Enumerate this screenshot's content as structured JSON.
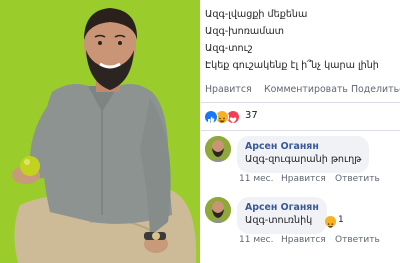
{
  "post": {
    "lines": [
      "Ազգ-լվացքի մեքենա",
      "Ազգ-խոռամատ",
      "Ազգ-տուշ",
      "Էկեք գուշակենք էլ ի՞նչ կարա լինի"
    ]
  },
  "actions": {
    "like": "Нравится",
    "comment": "Комментировать",
    "share": "Поделиться"
  },
  "reactions": {
    "icons": [
      "like-icon",
      "laugh-icon",
      "love-icon"
    ],
    "count": "37"
  },
  "comments": [
    {
      "author": "Арсен Оганян",
      "text": "Ազգ-զուգարանի թուղթ",
      "time": "11 мес.",
      "like": "Нравится",
      "reply": "Ответить"
    },
    {
      "author": "Арсен Оганян",
      "text": "Ազգ-տուռնիկ",
      "reaction_count": "1",
      "time": "11 мес.",
      "like": "Нравится",
      "reply": "Ответить"
    }
  ],
  "colors": {
    "photo_background": "#9acd2b",
    "link": "#385898",
    "muted": "#606770",
    "like_blue": "#1877f2",
    "love_red": "#f33e58",
    "haha_yellow": "#f7b125"
  }
}
